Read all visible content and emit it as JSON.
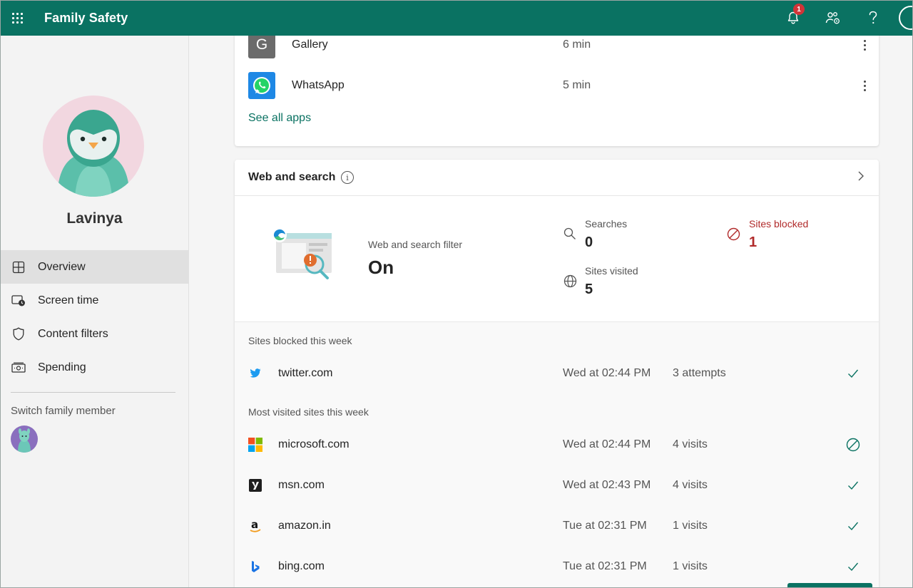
{
  "app": {
    "title": "Family Safety",
    "notification_count": "1"
  },
  "colors": {
    "brand": "#0a7262",
    "blocked_red": "#b12b2b"
  },
  "sidebar": {
    "profile_name": "Lavinya",
    "nav": [
      {
        "label": "Overview",
        "icon": "overview-icon",
        "active": true
      },
      {
        "label": "Screen time",
        "icon": "screen-time-icon"
      },
      {
        "label": "Content filters",
        "icon": "shield-icon"
      },
      {
        "label": "Spending",
        "icon": "money-icon"
      }
    ],
    "switch_label": "Switch family member"
  },
  "apps": {
    "items": [
      {
        "letter": "G",
        "name": "Gallery",
        "time": "6 min"
      },
      {
        "name": "WhatsApp",
        "time": "5 min"
      }
    ],
    "see_all": "See all apps"
  },
  "web": {
    "title": "Web and search",
    "filter_label": "Web and search filter",
    "filter_value": "On",
    "searches_label": "Searches",
    "searches_value": "0",
    "visited_label": "Sites visited",
    "visited_value": "5",
    "blocked_label": "Sites blocked",
    "blocked_value": "1",
    "blocked_section": "Sites blocked this week",
    "blocked_sites": [
      {
        "name": "twitter.com",
        "time": "Wed at 02:44 PM",
        "count": "3 attempts"
      }
    ],
    "visited_section": "Most visited sites this week",
    "visited_sites": [
      {
        "name": "microsoft.com",
        "time": "Wed at 02:44 PM",
        "count": "4 visits",
        "status": "block"
      },
      {
        "name": "msn.com",
        "time": "Wed at 02:43 PM",
        "count": "4 visits",
        "status": "allow"
      },
      {
        "name": "amazon.in",
        "time": "Tue at 02:31 PM",
        "count": "1 visits",
        "status": "allow"
      },
      {
        "name": "bing.com",
        "time": "Tue at 02:31 PM",
        "count": "1 visits",
        "status": "allow"
      }
    ]
  }
}
